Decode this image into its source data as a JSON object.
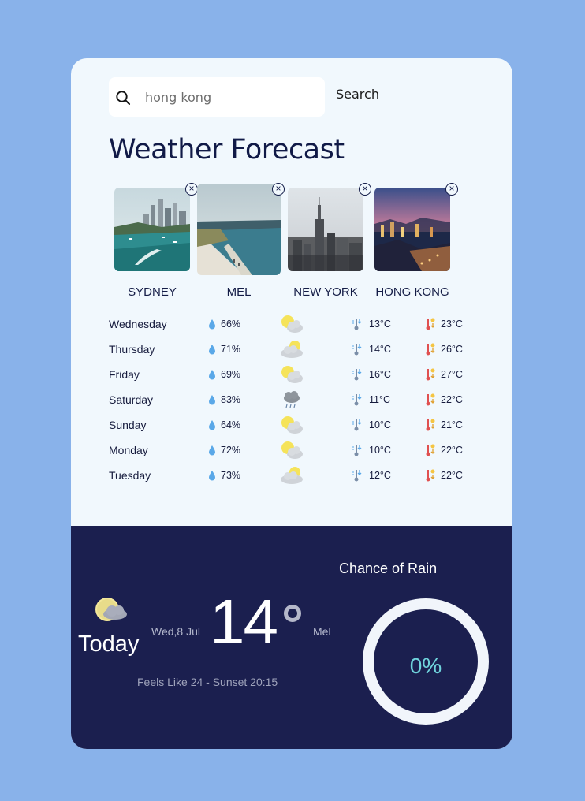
{
  "search": {
    "value": "hong kong",
    "button_label": "Search"
  },
  "title": "Weather Forecast",
  "cities": [
    {
      "name": "SYDNEY"
    },
    {
      "name": "MEL"
    },
    {
      "name": "NEW YORK"
    },
    {
      "name": "HONG KONG"
    }
  ],
  "forecast": [
    {
      "day": "Wednesday",
      "humidity": "66%",
      "icon": "sun-behind-cloud-icon",
      "min": "13°C",
      "max": "23°C"
    },
    {
      "day": "Thursday",
      "humidity": "71%",
      "icon": "cloud-partly-sunny-icon",
      "min": "14°C",
      "max": "26°C"
    },
    {
      "day": "Friday",
      "humidity": "69%",
      "icon": "sun-behind-cloud-icon",
      "min": "16°C",
      "max": "27°C"
    },
    {
      "day": "Saturday",
      "humidity": "83%",
      "icon": "rain-cloud-icon",
      "min": "11°C",
      "max": "22°C"
    },
    {
      "day": "Sunday",
      "humidity": "64%",
      "icon": "sun-behind-cloud-icon",
      "min": "10°C",
      "max": "21°C"
    },
    {
      "day": "Monday",
      "humidity": "72%",
      "icon": "sun-behind-cloud-icon",
      "min": "10°C",
      "max": "22°C"
    },
    {
      "day": "Tuesday",
      "humidity": "73%",
      "icon": "cloud-partly-sunny-icon",
      "min": "12°C",
      "max": "22°C"
    }
  ],
  "today": {
    "label": "Today",
    "date": "Wed,8 Jul",
    "temp": "14",
    "location": "Mel",
    "feels": "Feels Like 24 - Sunset 20:15"
  },
  "rain": {
    "title": "Chance of Rain",
    "value": "0%"
  },
  "colors": {
    "background": "#89b2ea",
    "card": "#f1f8fd",
    "panel": "#1b1f4f",
    "title": "#111a47",
    "rain_value": "#6fd3dc"
  }
}
